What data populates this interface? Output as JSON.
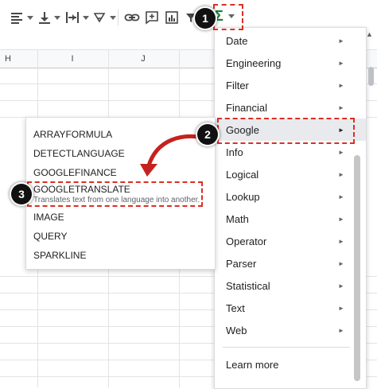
{
  "toolbar": {
    "icons": [
      "align-horizontal-icon",
      "align-vertical-icon",
      "text-wrap-icon",
      "text-rotate-icon",
      "link-icon",
      "comment-icon",
      "chart-icon",
      "filter-icon",
      "functions-icon"
    ],
    "functions_symbol": "Σ"
  },
  "grid": {
    "columns": [
      "H",
      "I",
      "J"
    ]
  },
  "function_menu": {
    "items": [
      {
        "label": "Date",
        "has_submenu": true
      },
      {
        "label": "Engineering",
        "has_submenu": true
      },
      {
        "label": "Filter",
        "has_submenu": true
      },
      {
        "label": "Financial",
        "has_submenu": true
      },
      {
        "label": "Google",
        "has_submenu": true,
        "active": true
      },
      {
        "label": "Info",
        "has_submenu": true
      },
      {
        "label": "Logical",
        "has_submenu": true
      },
      {
        "label": "Lookup",
        "has_submenu": true
      },
      {
        "label": "Math",
        "has_submenu": true
      },
      {
        "label": "Operator",
        "has_submenu": true
      },
      {
        "label": "Parser",
        "has_submenu": true
      },
      {
        "label": "Statistical",
        "has_submenu": true
      },
      {
        "label": "Text",
        "has_submenu": true
      },
      {
        "label": "Web",
        "has_submenu": true
      }
    ],
    "learn_more": "Learn more",
    "arrow_glyph": "►"
  },
  "google_submenu": {
    "items": [
      {
        "label": "ARRAYFORMULA"
      },
      {
        "label": "DETECTLANGUAGE"
      },
      {
        "label": "GOOGLEFINANCE"
      },
      {
        "label": "GOOGLETRANSLATE",
        "description": "Translates text from one language into another."
      },
      {
        "label": "IMAGE"
      },
      {
        "label": "QUERY"
      },
      {
        "label": "SPARKLINE"
      }
    ]
  },
  "annotations": {
    "step1": "1",
    "step2": "2",
    "step3": "3",
    "highlight_color": "#d93025"
  },
  "colors": {
    "functions_green": "#188038",
    "badge_bg": "#111111"
  }
}
